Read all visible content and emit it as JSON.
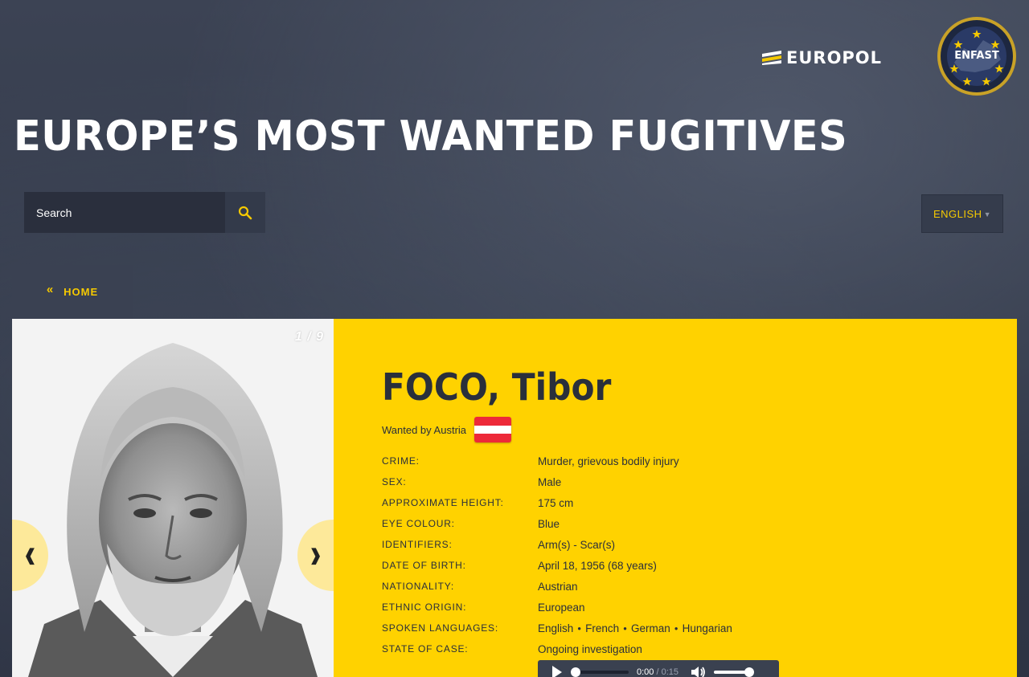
{
  "header": {
    "europol_logo_text": "EUROPOL",
    "enfast_logo_text": "ENFAST",
    "page_title": "EUROPE’S MOST WANTED FUGITIVES"
  },
  "search": {
    "placeholder": "Search"
  },
  "language": {
    "selected": "ENGLISH"
  },
  "nav": {
    "home_chevron": "«",
    "home_label": "HOME"
  },
  "gallery": {
    "counter": "1 / 9",
    "prev_symbol": "❰",
    "next_symbol": "❱"
  },
  "fugitive": {
    "name": "FOCO, Tibor",
    "wanted_by": "Wanted by Austria",
    "flag_colors": [
      "#ed2939",
      "#ffffff",
      "#ed2939"
    ],
    "details": [
      {
        "label": "CRIME:",
        "value": "Murder, grievous bodily injury"
      },
      {
        "label": "SEX:",
        "value": "Male"
      },
      {
        "label": "APPROXIMATE HEIGHT:",
        "value": "175 cm"
      },
      {
        "label": "EYE COLOUR:",
        "value": "Blue"
      },
      {
        "label": "IDENTIFIERS:",
        "value": "Arm(s) - Scar(s)"
      },
      {
        "label": "DATE OF BIRTH:",
        "value": "April 18, 1956 (68 years)"
      },
      {
        "label": "NATIONALITY:",
        "value": "Austrian"
      },
      {
        "label": "ETHNIC ORIGIN:",
        "value": "European"
      }
    ],
    "languages_label": "SPOKEN LANGUAGES:",
    "languages": [
      "English",
      "French",
      "German",
      "Hungarian"
    ],
    "state_label": "STATE OF CASE:",
    "state_value": "Ongoing investigation"
  },
  "audio": {
    "current_time": "0:00",
    "separator": "/",
    "duration": "0:15"
  },
  "colors": {
    "accent_yellow": "#ffd200",
    "nav_yellow": "#f5c900",
    "dark_panel": "#3a4152"
  }
}
